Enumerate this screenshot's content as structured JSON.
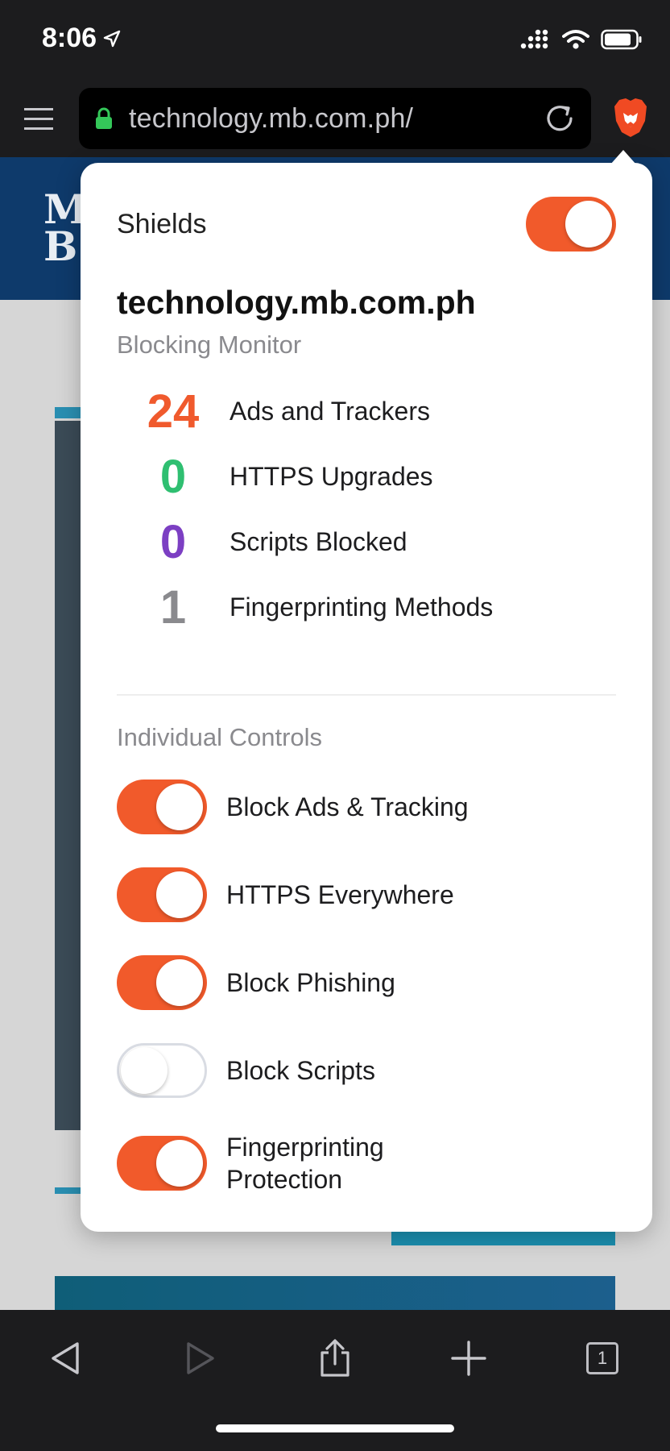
{
  "status": {
    "time": "8:06"
  },
  "browser": {
    "url": "technology.mb.com.ph/"
  },
  "site": {
    "logo_line1": "M",
    "logo_line2": "B"
  },
  "shields": {
    "label": "Shields",
    "enabled": true,
    "domain": "technology.mb.com.ph",
    "blocking_monitor_title": "Blocking Monitor",
    "stats": [
      {
        "count": "24",
        "label": "Ads and Trackers",
        "color": "#f05a2d"
      },
      {
        "count": "0",
        "label": "HTTPS Upgrades",
        "color": "#2fbf71"
      },
      {
        "count": "0",
        "label": "Scripts Blocked",
        "color": "#7c3fc3"
      },
      {
        "count": "1",
        "label": "Fingerprinting Methods",
        "color": "#8a8a8e"
      }
    ],
    "individual_controls_title": "Individual Controls",
    "controls": [
      {
        "label": "Block Ads & Tracking",
        "enabled": true
      },
      {
        "label": "HTTPS Everywhere",
        "enabled": true
      },
      {
        "label": "Block Phishing",
        "enabled": true
      },
      {
        "label": "Block Scripts",
        "enabled": false
      },
      {
        "label_line1": "Fingerprinting",
        "label_line2": "Protection",
        "enabled": true
      }
    ]
  },
  "toolbar": {
    "tab_count": "1"
  },
  "colors": {
    "accent": "#f15a2b",
    "chrome": "#1c1c1e",
    "site_header": "#0e3a6b"
  }
}
